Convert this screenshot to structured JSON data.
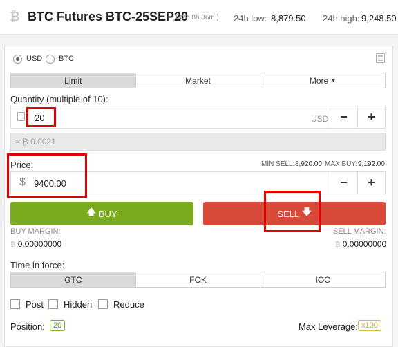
{
  "header": {
    "title": "BTC Futures BTC-25SEP20",
    "expiry": "(142d 8h 36m )",
    "low_label": "24h low:",
    "low_value": "8,879.50",
    "high_label": "24h high:",
    "high_value": "9,248.50"
  },
  "currency": {
    "usd_label": "USD",
    "btc_label": "BTC",
    "selected": "USD"
  },
  "order_tabs": [
    "Limit",
    "Market",
    "More"
  ],
  "quantity": {
    "label": "Quantity (multiple of 10):",
    "value": "20",
    "unit": "USD",
    "btc_equiv": "≈ ₿ 0.0021"
  },
  "price": {
    "label": "Price:",
    "value": "9400.00",
    "min_sell_label": "MIN SELL:",
    "min_sell_value": "8,920.00",
    "max_buy_label": "MAX BUY:",
    "max_buy_value": "9,192.00"
  },
  "buttons": {
    "buy": "BUY",
    "sell": "SELL"
  },
  "margin": {
    "buy_label": "BUY MARGIN:",
    "buy_value": "0.00000000",
    "sell_label": "SELL MARGIN:",
    "sell_value": "0.00000000"
  },
  "tif": {
    "label": "Time in force:",
    "options": [
      "GTC",
      "FOK",
      "IOC"
    ]
  },
  "flags": [
    "Post",
    "Hidden",
    "Reduce"
  ],
  "position": {
    "label": "Position:",
    "value": "20"
  },
  "leverage": {
    "label": "Max Leverage:",
    "value": "x100"
  },
  "colors": {
    "buy": "#7aab1e",
    "sell": "#d9493a",
    "highlight": "#e00000",
    "badge_green": "#7aab1e",
    "badge_yellow": "#d9b84a"
  },
  "icons": [
    "bitcoin-icon",
    "calculator-icon",
    "copy-icon",
    "dollar-icon",
    "arrow-up-icon",
    "arrow-down-icon",
    "caret-down-icon"
  ]
}
